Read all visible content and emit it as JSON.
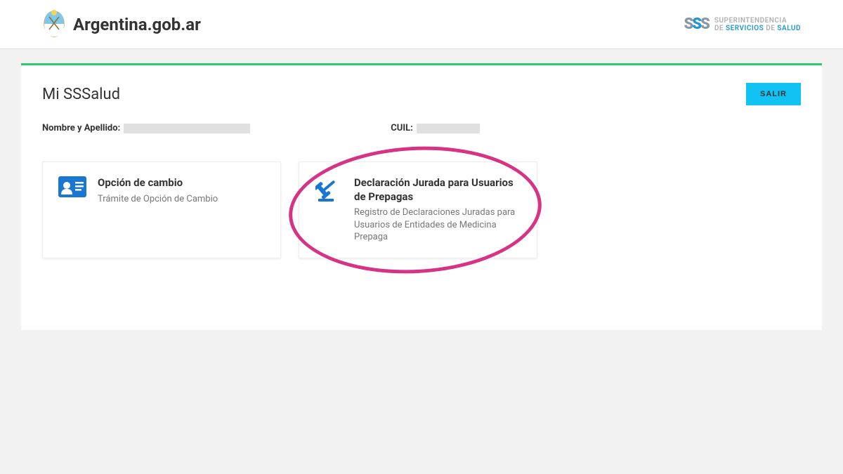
{
  "header": {
    "brand_text": "Argentina.gob.ar",
    "org_line1": "SUPERINTENDENCIA",
    "org_line2_prefix": "DE ",
    "org_line2_accent": "SERVICIOS",
    "org_line2_suffix": " DE ",
    "org_line3": "SALUD"
  },
  "panel": {
    "title": "Mi SSSalud",
    "exit_label": "SALIR",
    "name_label": "Nombre y Apellido:",
    "cuil_label": "CUIL:"
  },
  "cards": [
    {
      "title": "Opción de cambio",
      "desc": "Trámite de Opción de Cambio"
    },
    {
      "title": "Declaración Jurada para Usuarios de Prepagas",
      "desc": "Registro de Declaraciones Juradas para Usuarios de Entidades de Medicina Prepaga"
    }
  ]
}
